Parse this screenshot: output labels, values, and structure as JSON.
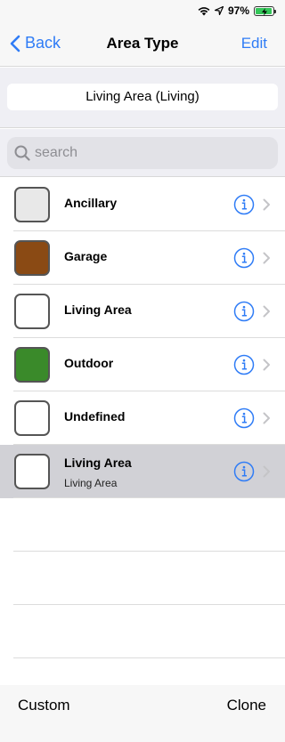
{
  "status_bar": {
    "battery": "97%",
    "battery_level": 0.97
  },
  "nav": {
    "back_label": "Back",
    "title": "Area Type",
    "edit_label": "Edit"
  },
  "current_selection": "Living Area (Living)",
  "search": {
    "placeholder": "search",
    "value": ""
  },
  "area_types": [
    {
      "name": "Ancillary",
      "color": "#e8e8e8"
    },
    {
      "name": "Garage",
      "color": "#8a4a14"
    },
    {
      "name": "Living Area",
      "color": "#ffffff"
    },
    {
      "name": "Outdoor",
      "color": "#3a8a2a"
    },
    {
      "name": "Undefined",
      "color": "#ffffff"
    },
    {
      "name": "Living Area",
      "subtitle": "Living Area",
      "color": "#ffffff",
      "selected": true
    }
  ],
  "toolbar": {
    "custom_label": "Custom",
    "clone_label": "Clone"
  },
  "colors": {
    "accent": "#2f7cf6",
    "selected_row": "#d1d1d6"
  }
}
